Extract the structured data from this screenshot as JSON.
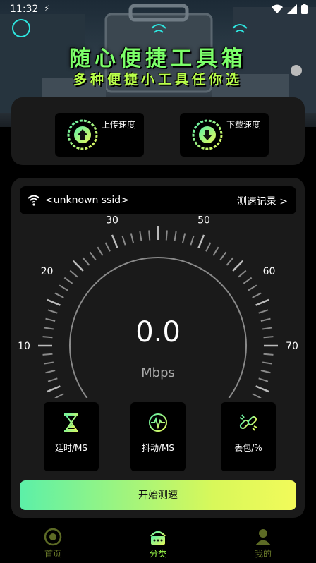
{
  "status_bar": {
    "time": "11:32"
  },
  "banner": {
    "title": "随心便捷工具箱",
    "subtitle": "多种便捷小工具任你选"
  },
  "speed_buttons": {
    "upload_label": "上传速度",
    "download_label": "下载速度"
  },
  "network": {
    "ssid": "<unknown ssid>",
    "history_link": "测速记录  >"
  },
  "gauge": {
    "tick_labels": [
      "10",
      "20",
      "30",
      "50",
      "60",
      "70"
    ],
    "value": "0.0",
    "unit": "Mbps",
    "accent_color": "#2ee6a0"
  },
  "metrics": {
    "latency_label": "延时/MS",
    "jitter_label": "抖动/MS",
    "loss_label": "丢包/%"
  },
  "start_button_label": "开始测速",
  "bottom_nav": {
    "home_label": "首页",
    "category_label": "分类",
    "mine_label": "我的",
    "active": "分类",
    "active_color": "#9dff4a",
    "inactive_color": "#6a7a2a"
  }
}
